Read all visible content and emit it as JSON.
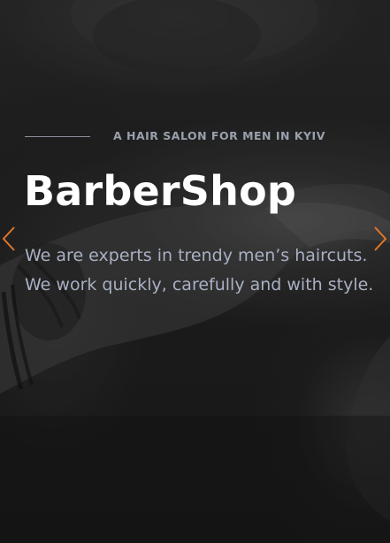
{
  "hero": {
    "tagline": "A HAIR SALON FOR MEN IN KYIV",
    "title": "BarberShop",
    "description": "We are experts in trendy men’s haircuts. We work quickly, carefully and with style."
  },
  "slider": {
    "prev_icon": "chevron-left-icon",
    "next_icon": "chevron-right-icon",
    "arrow_color": "#e0762a"
  },
  "colors": {
    "tagline": "#9aa0ad",
    "title": "#ffffff",
    "description": "#a9b0c4",
    "background": "#1f1f1f"
  }
}
